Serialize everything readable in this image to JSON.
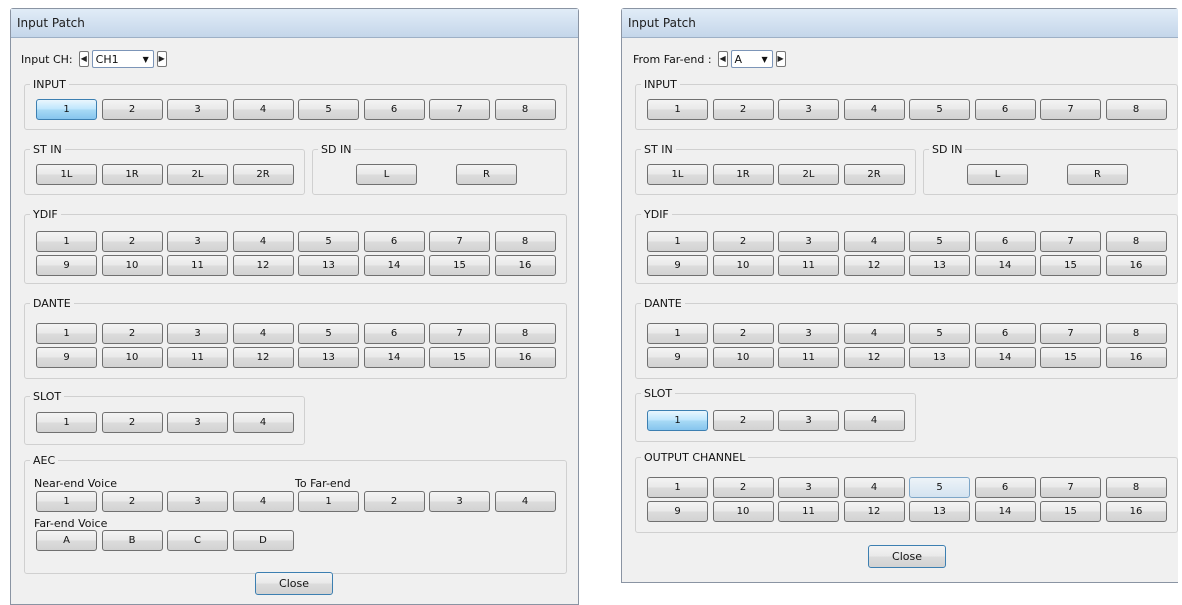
{
  "windowA": {
    "title": "Input Patch",
    "selector": {
      "label": "Input CH:",
      "value": "CH1"
    },
    "input": {
      "legend": "INPUT",
      "buttons": [
        "1",
        "2",
        "3",
        "4",
        "5",
        "6",
        "7",
        "8"
      ],
      "selected": "1"
    },
    "stin": {
      "legend": "ST IN",
      "buttons": [
        "1L",
        "1R",
        "2L",
        "2R"
      ]
    },
    "sdin": {
      "legend": "SD IN",
      "buttons": [
        "L",
        "R"
      ]
    },
    "ydif": {
      "legend": "YDIF",
      "row1": [
        "1",
        "2",
        "3",
        "4",
        "5",
        "6",
        "7",
        "8"
      ],
      "row2": [
        "9",
        "10",
        "11",
        "12",
        "13",
        "14",
        "15",
        "16"
      ]
    },
    "dante": {
      "legend": "DANTE",
      "row1": [
        "1",
        "2",
        "3",
        "4",
        "5",
        "6",
        "7",
        "8"
      ],
      "row2": [
        "9",
        "10",
        "11",
        "12",
        "13",
        "14",
        "15",
        "16"
      ]
    },
    "slot": {
      "legend": "SLOT",
      "buttons": [
        "1",
        "2",
        "3",
        "4"
      ]
    },
    "aec": {
      "legend": "AEC",
      "near_label": "Near-end Voice",
      "near": [
        "1",
        "2",
        "3",
        "4"
      ],
      "tofar_label": "To Far-end",
      "tofar": [
        "1",
        "2",
        "3",
        "4"
      ],
      "far_label": "Far-end Voice",
      "far": [
        "A",
        "B",
        "C",
        "D"
      ]
    },
    "close": "Close"
  },
  "windowB": {
    "title": "Input Patch",
    "selector": {
      "label": "From Far-end :",
      "value": "A"
    },
    "input": {
      "legend": "INPUT",
      "buttons": [
        "1",
        "2",
        "3",
        "4",
        "5",
        "6",
        "7",
        "8"
      ]
    },
    "stin": {
      "legend": "ST IN",
      "buttons": [
        "1L",
        "1R",
        "2L",
        "2R"
      ]
    },
    "sdin": {
      "legend": "SD IN",
      "buttons": [
        "L",
        "R"
      ]
    },
    "ydif": {
      "legend": "YDIF",
      "row1": [
        "1",
        "2",
        "3",
        "4",
        "5",
        "6",
        "7",
        "8"
      ],
      "row2": [
        "9",
        "10",
        "11",
        "12",
        "13",
        "14",
        "15",
        "16"
      ]
    },
    "dante": {
      "legend": "DANTE",
      "row1": [
        "1",
        "2",
        "3",
        "4",
        "5",
        "6",
        "7",
        "8"
      ],
      "row2": [
        "9",
        "10",
        "11",
        "12",
        "13",
        "14",
        "15",
        "16"
      ]
    },
    "slot": {
      "legend": "SLOT",
      "buttons": [
        "1",
        "2",
        "3",
        "4"
      ],
      "selected": "1"
    },
    "output": {
      "legend": "OUTPUT CHANNEL",
      "row1": [
        "1",
        "2",
        "3",
        "4",
        "5",
        "6",
        "7",
        "8"
      ],
      "row2": [
        "9",
        "10",
        "11",
        "12",
        "13",
        "14",
        "15",
        "16"
      ],
      "highlighted": "5"
    },
    "close": "Close"
  },
  "colors": {
    "selected": "#86c5ee",
    "title_bar": "#c4d6ea",
    "panel": "#f0f0f0"
  },
  "icons": {
    "prev": "left-arrow-icon",
    "next": "right-arrow-icon",
    "dropdown": "chevron-down-icon"
  }
}
